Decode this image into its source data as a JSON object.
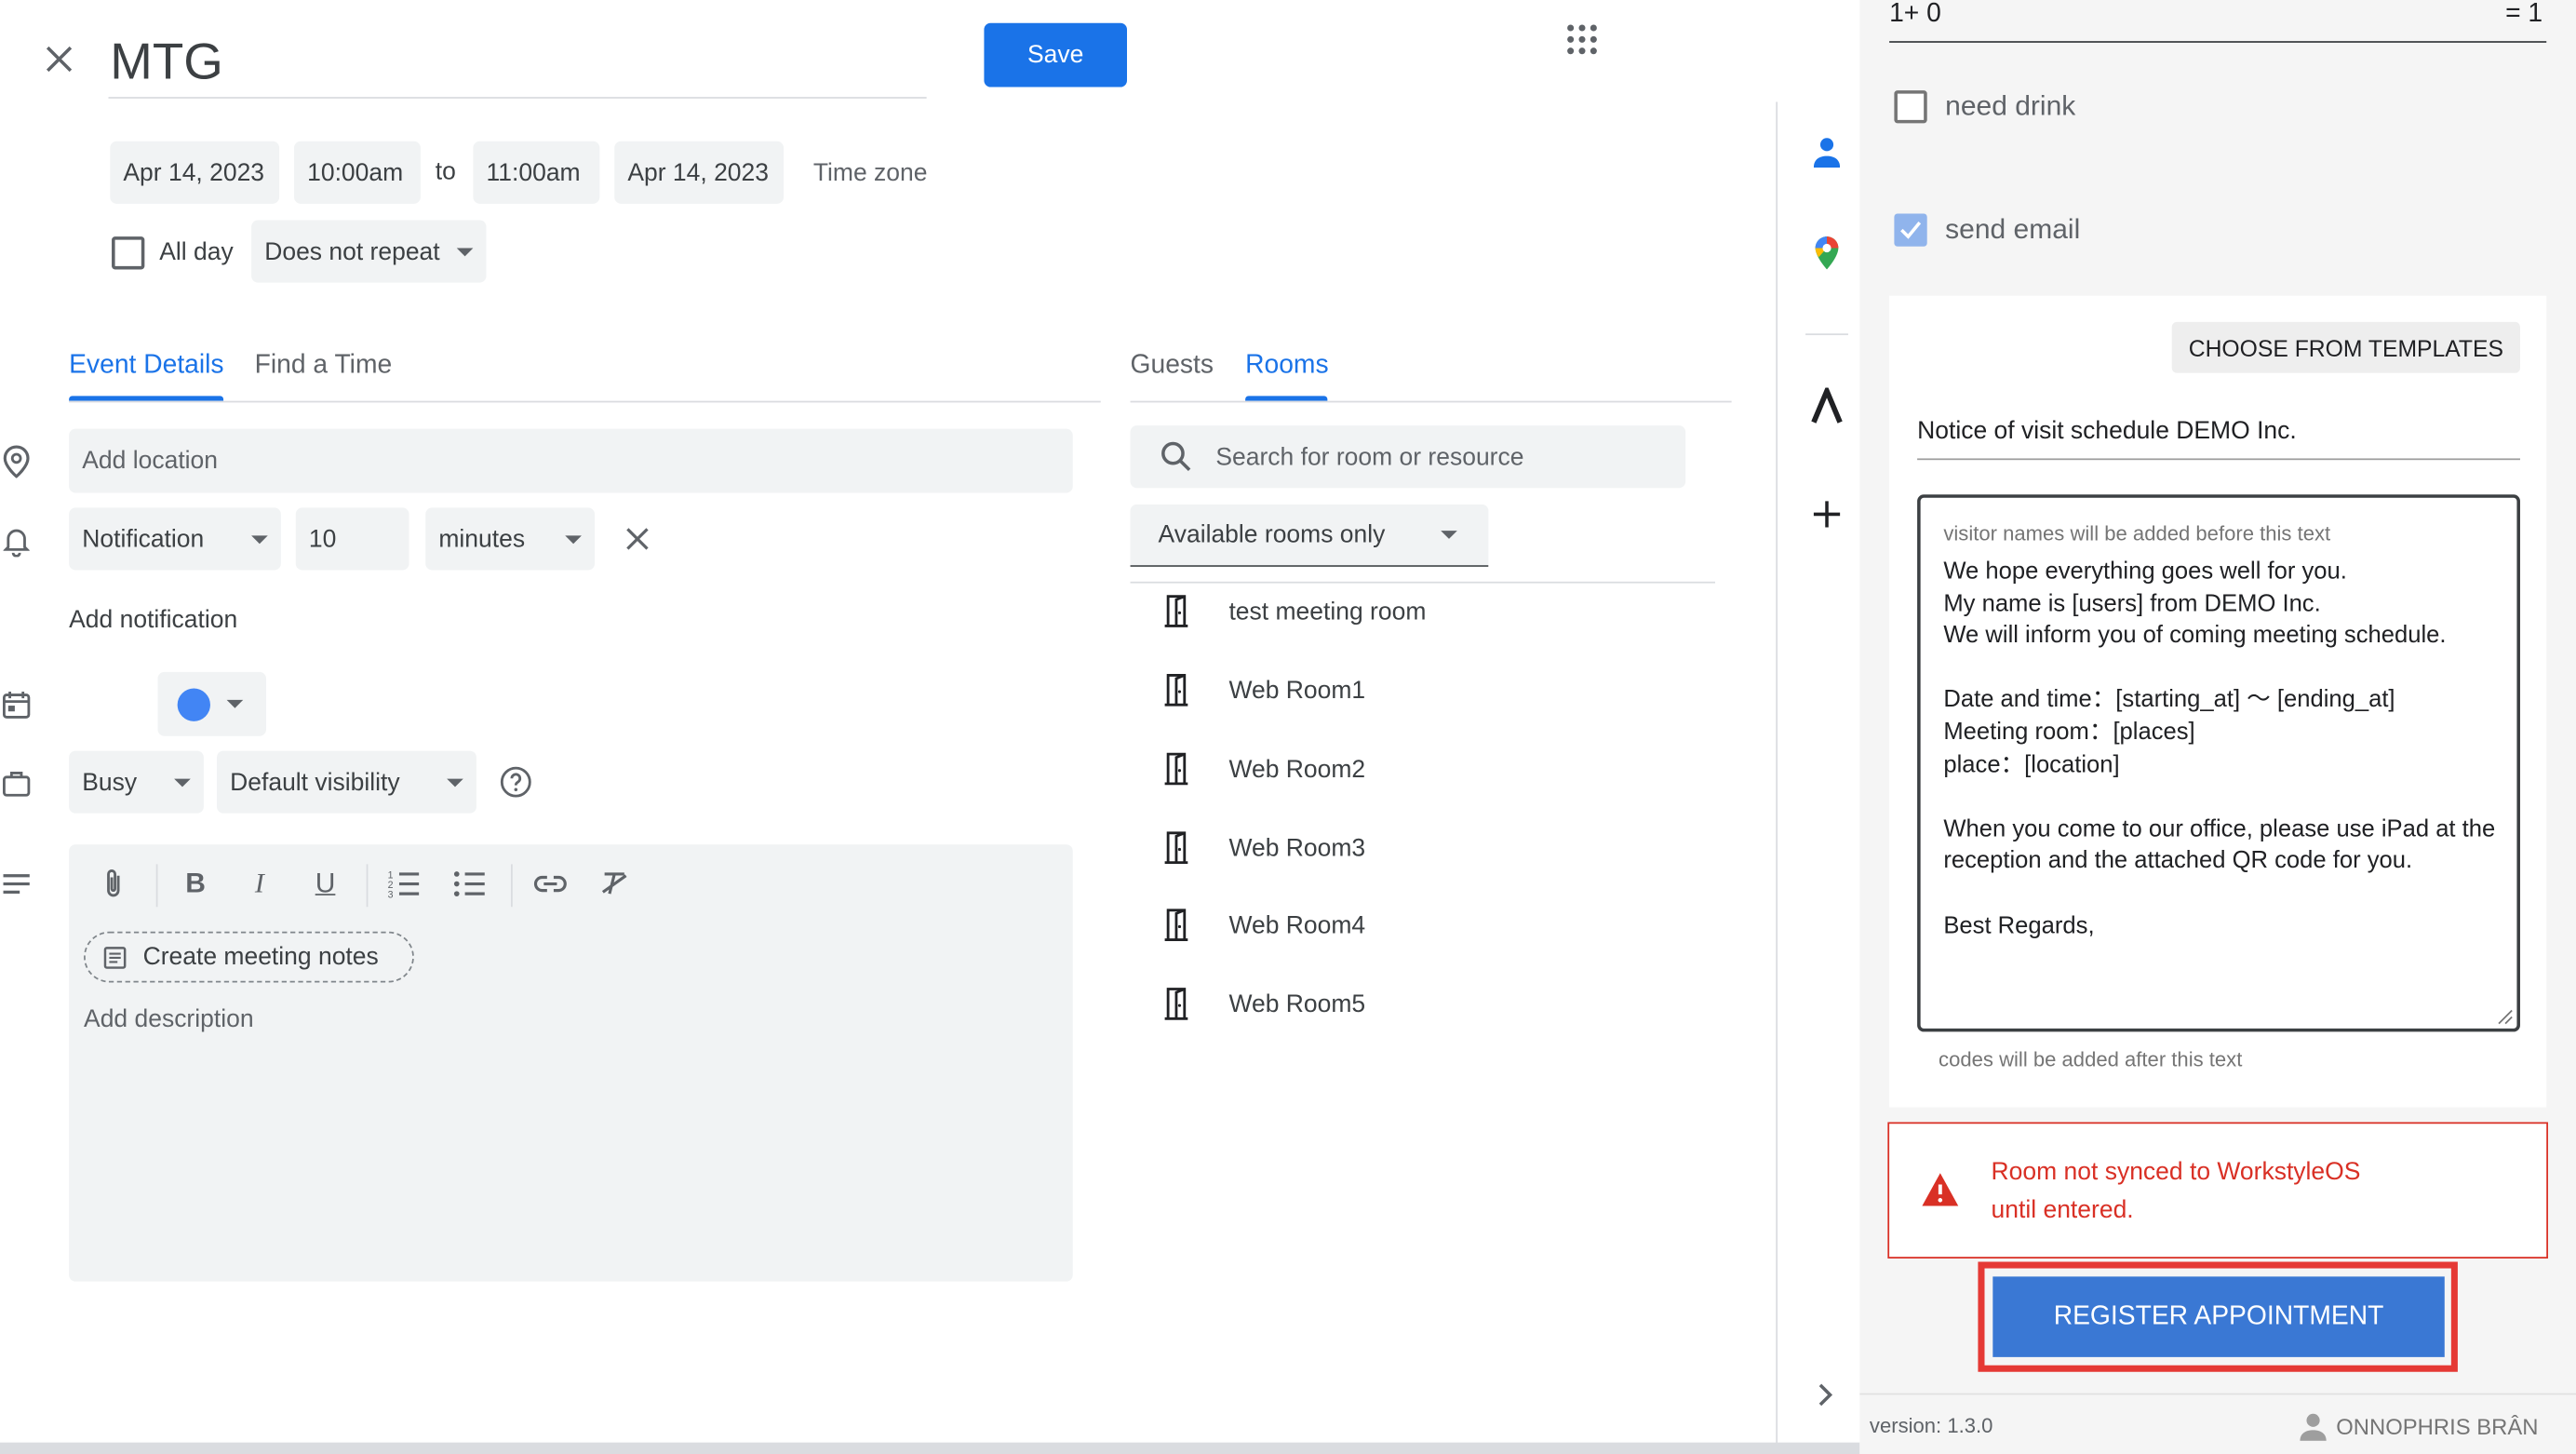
{
  "event": {
    "title": "MTG",
    "save_label": "Save",
    "start_date": "Apr 14, 2023",
    "start_time": "10:00am",
    "to_label": "to",
    "end_time": "11:00am",
    "end_date": "Apr 14, 2023",
    "timezone_label": "Time zone",
    "all_day_label": "All day",
    "repeat_value": "Does not repeat"
  },
  "tabs": {
    "details": "Event Details",
    "find_time": "Find a Time",
    "guests": "Guests",
    "rooms": "Rooms"
  },
  "details": {
    "location_placeholder": "Add location",
    "notification_type": "Notification",
    "notification_value": "10",
    "notification_unit": "minutes",
    "add_notification": "Add notification",
    "calendar_color": "#4285f4",
    "busy_value": "Busy",
    "visibility_value": "Default visibility",
    "meeting_notes_label": "Create meeting notes",
    "description_placeholder": "Add description"
  },
  "rooms": {
    "search_placeholder": "Search for room or resource",
    "filter_value": "Available rooms only",
    "items": [
      "test meeting room",
      "Web Room1",
      "Web Room2",
      "Web Room3",
      "Web Room4",
      "Web Room5"
    ]
  },
  "addon": {
    "formula_left": "1+ 0",
    "formula_right": "= 1",
    "need_drink_label": "need drink",
    "need_drink_checked": false,
    "send_email_label": "send email",
    "send_email_checked": true,
    "templates_button": "CHOOSE FROM TEMPLATES",
    "subject_value": "Notice of visit schedule DEMO Inc.",
    "before_hint": "visitor names will be added before this text",
    "body_text": "We hope everything goes well for you.\nMy name is [users] from DEMO Inc.\nWe will inform you of coming meeting schedule.\n\nDate and time：[starting_at] 〜 [ending_at]\nMeeting room：[places]\nplace：[location]\n\nWhen you come to our office, please use iPad at the reception and the attached QR code for you.\n\nBest Regards,",
    "after_hint": "codes will be added after this text",
    "warning_text": "Room not synced to WorkstyleOS until entered.",
    "register_button": "REGISTER APPOINTMENT",
    "version": "version: 1.3.0",
    "user_name": "ONNOPHRIS BRÂN"
  },
  "colors": {
    "accent": "#1a73e8",
    "warning": "#d93025",
    "register": "#3a78d4"
  }
}
